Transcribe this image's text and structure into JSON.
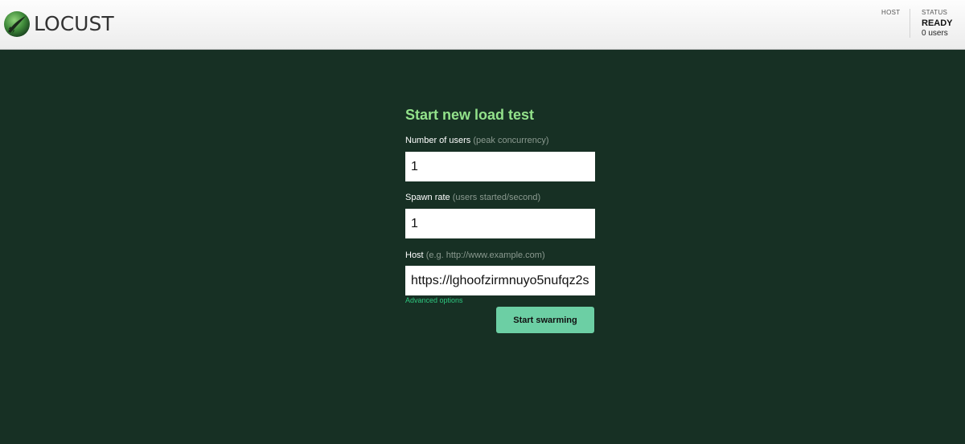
{
  "app": {
    "logo_text": "LOCUST"
  },
  "header": {
    "host_label": "HOST",
    "status_label": "STATUS",
    "status_value": "READY",
    "users_value": "0 users"
  },
  "form": {
    "title": "Start new load test",
    "users_label": "Number of users",
    "users_hint": "(peak concurrency)",
    "users_value": "1",
    "spawn_label": "Spawn rate",
    "spawn_hint": "(users started/second)",
    "spawn_value": "1",
    "host_label": "Host",
    "host_hint": "(e.g. http://www.example.com)",
    "host_value": "https://lghoofzirmnuyo5nufqz2s",
    "advanced_link": "Advanced options",
    "start_button": "Start swarming"
  },
  "colors": {
    "background": "#173024",
    "title": "#93e28b",
    "accent_link": "#2ec77f",
    "button": "#6ccfa4"
  }
}
